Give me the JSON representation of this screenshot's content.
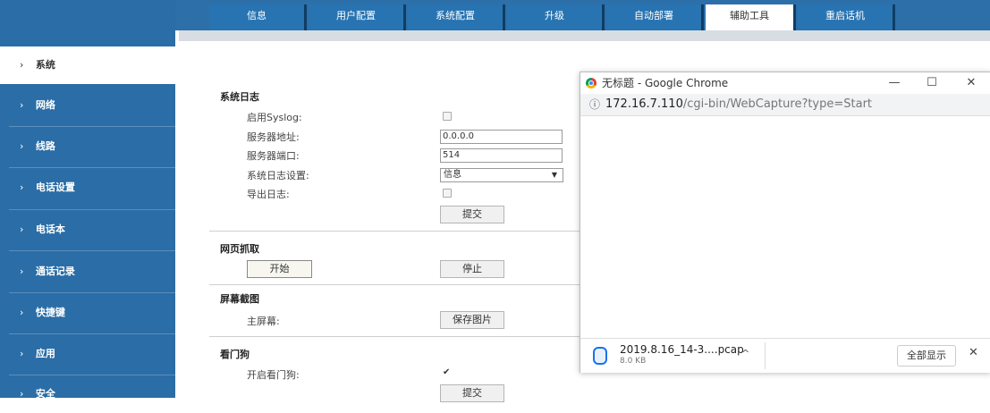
{
  "tabs": [
    "信息",
    "用户配置",
    "系统配置",
    "升级",
    "自动部署",
    "辅助工具",
    "重启话机"
  ],
  "active_tab": "辅助工具",
  "sidebar": {
    "items": [
      {
        "label": "系统",
        "active": true
      },
      {
        "label": "网络"
      },
      {
        "label": "线路"
      },
      {
        "label": "电话设置"
      },
      {
        "label": "电话本"
      },
      {
        "label": "通话记录"
      },
      {
        "label": "快捷键"
      },
      {
        "label": "应用"
      },
      {
        "label": "安全"
      }
    ],
    "chevron": "›"
  },
  "syslog": {
    "title": "系统日志",
    "enable_label": "启用Syslog:",
    "server_addr_label": "服务器地址:",
    "server_addr_value": "0.0.0.0",
    "server_port_label": "服务器端口:",
    "server_port_value": "514",
    "log_level_label": "系统日志设置:",
    "log_level_value": "信息",
    "export_label": "导出日志:",
    "submit": "提交"
  },
  "capture": {
    "title": "网页抓取",
    "start": "开始",
    "stop": "停止"
  },
  "screenshot": {
    "title": "屏幕截图",
    "main_screen_label": "主屏幕:",
    "save": "保存图片"
  },
  "watchdog": {
    "title": "看门狗",
    "enable_label": "开启看门狗:",
    "enabled": true,
    "submit": "提交"
  },
  "popup": {
    "window_title": "无标题 - Google Chrome",
    "url_host": "172.16.7.110",
    "url_path": "/cgi-bin/WebCapture?type=Start",
    "minimize": "—",
    "maximize": "☐",
    "close": "✕",
    "info_icon": "ⓘ",
    "download": {
      "filename": "2019.8.16_14-3....pcap",
      "size": "8.0 KB",
      "show_all": "全部显示",
      "close": "✕",
      "chevron": "^"
    }
  },
  "colors": {
    "sidebar_bg": "#2b6da6",
    "tab_bg": "#2874b2",
    "tab_active_bg": "#ffffff"
  }
}
